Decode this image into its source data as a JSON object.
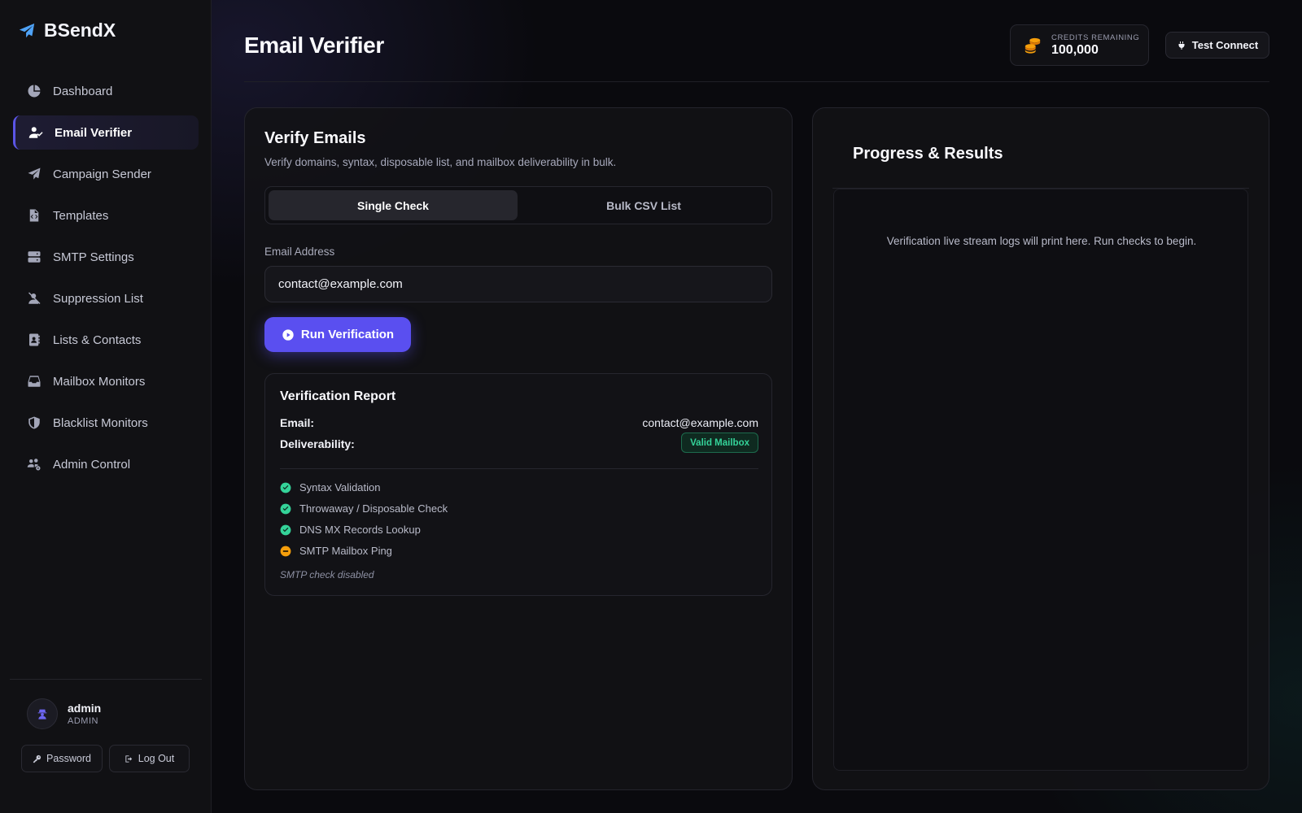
{
  "app": {
    "name": "BSendX",
    "logo_icon": "paper-plane-icon"
  },
  "sidebar": {
    "items": [
      {
        "label": "Dashboard",
        "icon": "chart-pie-icon"
      },
      {
        "label": "Email Verifier",
        "icon": "user-check-icon",
        "active": true
      },
      {
        "label": "Campaign Sender",
        "icon": "paper-plane-icon"
      },
      {
        "label": "Templates",
        "icon": "file-code-icon"
      },
      {
        "label": "SMTP Settings",
        "icon": "server-icon"
      },
      {
        "label": "Suppression List",
        "icon": "user-slash-icon"
      },
      {
        "label": "Lists & Contacts",
        "icon": "address-book-icon"
      },
      {
        "label": "Mailbox Monitors",
        "icon": "inbox-icon"
      },
      {
        "label": "Blacklist Monitors",
        "icon": "shield-icon"
      },
      {
        "label": "Admin Control",
        "icon": "users-gear-icon"
      }
    ],
    "user": {
      "name": "admin",
      "role": "ADMIN"
    },
    "password_label": "Password",
    "logout_label": "Log Out"
  },
  "header": {
    "title": "Email Verifier",
    "credits_label": "CREDITS REMAINING",
    "credits_value": "100,000",
    "test_connect_label": "Test Connect"
  },
  "verify": {
    "title": "Verify Emails",
    "subtitle": "Verify domains, syntax, disposable list, and mailbox deliverability in bulk.",
    "tabs": [
      {
        "label": "Single Check",
        "active": true
      },
      {
        "label": "Bulk CSV List",
        "active": false
      }
    ],
    "email_label": "Email Address",
    "email_value": "contact@example.com",
    "run_label": "Run Verification"
  },
  "report": {
    "title": "Verification Report",
    "email_key": "Email:",
    "email_value": "contact@example.com",
    "deliverability_key": "Deliverability:",
    "deliverability_value": "Valid Mailbox",
    "checks": [
      {
        "label": "Syntax Validation",
        "status": "pass"
      },
      {
        "label": "Throwaway / Disposable Check",
        "status": "pass"
      },
      {
        "label": "DNS MX Records Lookup",
        "status": "pass"
      },
      {
        "label": "SMTP Mailbox Ping",
        "status": "skipped"
      }
    ],
    "note": "SMTP check disabled"
  },
  "progress": {
    "title": "Progress & Results",
    "empty_message": "Verification live stream logs will print here. Run checks to begin."
  },
  "colors": {
    "accent": "#5a4ff0",
    "success": "#34d399",
    "warning": "#f59e0b",
    "credits": "#f59e0b"
  }
}
